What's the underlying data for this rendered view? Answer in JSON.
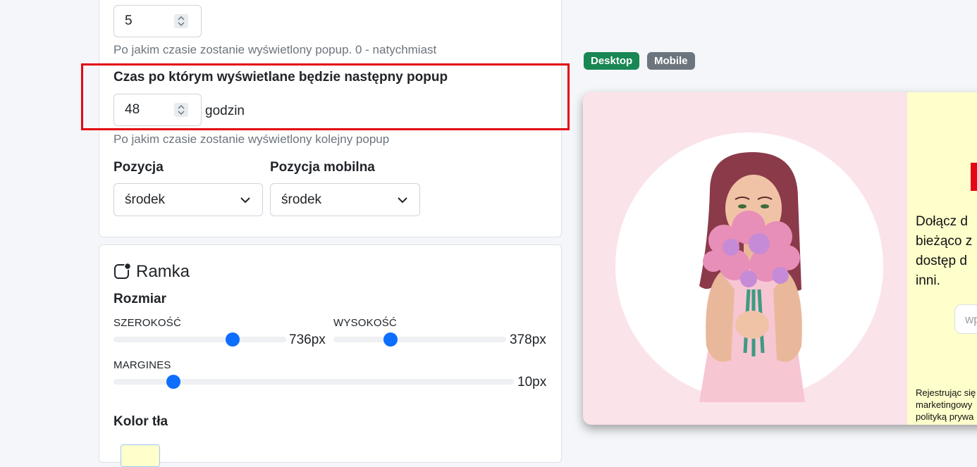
{
  "delay": {
    "value": "5",
    "help": "Po jakim czasie zostanie wyświetlony popup. 0 - natychmiast"
  },
  "next_popup": {
    "label": "Czas po którym wyświetlane będzie następny popup",
    "value": "48",
    "unit": "godzin",
    "help": "Po jakim czasie zostanie wyświetlony kolejny popup"
  },
  "position": {
    "label": "Pozycja",
    "selected": "środek"
  },
  "position_mobile": {
    "label": "Pozycja mobilna",
    "selected": "środek"
  },
  "frame": {
    "title": "Ramka",
    "size_label": "Rozmiar",
    "width_label": "SZEROKOŚĆ",
    "width_value": "736px",
    "width_fraction": 0.69,
    "height_label": "WYSOKOŚĆ",
    "height_value": "378px",
    "height_fraction": 0.33,
    "margin_label": "MARGINES",
    "margin_value": "10px",
    "margin_fraction": 0.15,
    "bg_color_label": "Kolor tła"
  },
  "preview": {
    "tab_desktop": "Desktop",
    "tab_mobile": "Mobile",
    "text_lines": [
      "Dołącz d",
      "bieżąco z",
      "dostęp d",
      "inni."
    ],
    "input_placeholder": "wp",
    "disclaimer_lines": [
      "Rejestrując się",
      "marketingowy",
      "polityką prywa"
    ]
  },
  "colors": {
    "accent": "#0d6efd",
    "desktop_badge": "#198754",
    "mobile_badge": "#6c757d",
    "highlight": "#e30613",
    "preview_left_bg": "#fbe3ea",
    "preview_right_bg": "#ffffcc"
  }
}
